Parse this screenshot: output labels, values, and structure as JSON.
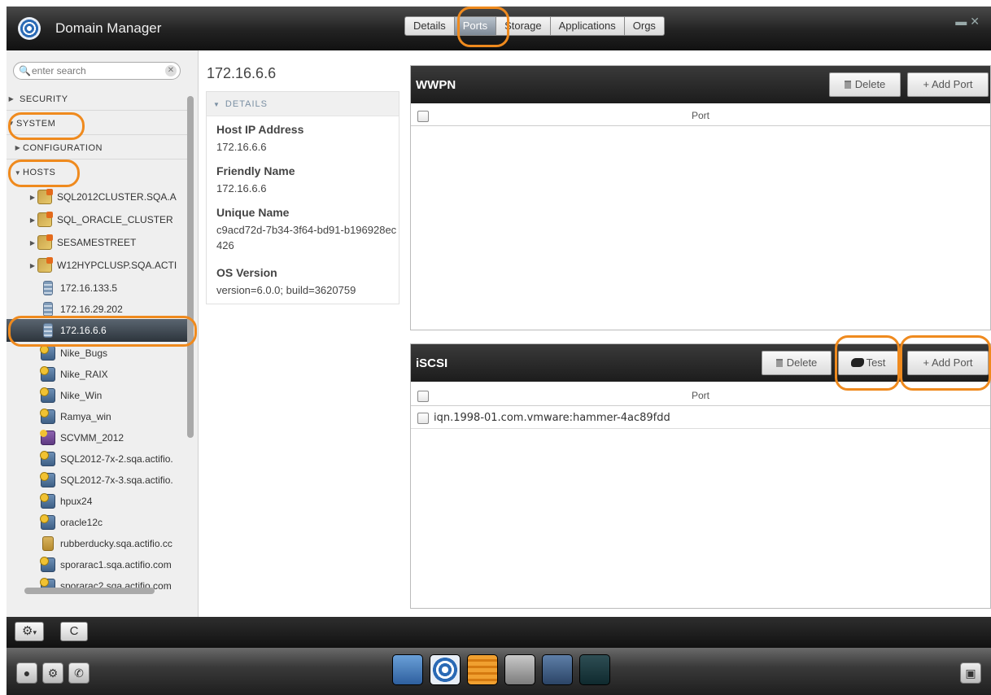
{
  "app": {
    "title": "Domain Manager"
  },
  "tabs": [
    {
      "label": "Details"
    },
    {
      "label": "Ports"
    },
    {
      "label": "Storage"
    },
    {
      "label": "Applications"
    },
    {
      "label": "Orgs"
    }
  ],
  "search": {
    "placeholder": "enter search"
  },
  "tree": {
    "security": "SECURITY",
    "system": "SYSTEM",
    "configuration": "CONFIGURATION",
    "hosts": "HOSTS",
    "items": [
      {
        "label": "SQL2012CLUSTER.SQA.A",
        "icon": "cluster-icon"
      },
      {
        "label": "SQL_ORACLE_CLUSTER",
        "icon": "cluster-icon"
      },
      {
        "label": "SESAMESTREET",
        "icon": "cluster-icon"
      },
      {
        "label": "W12HYPCLUSP.SQA.ACTI",
        "icon": "cluster-icon"
      },
      {
        "label": "172.16.133.5",
        "icon": "server-icon"
      },
      {
        "label": "172.16.29.202",
        "icon": "server-icon"
      },
      {
        "label": "172.16.6.6",
        "icon": "server-icon"
      },
      {
        "label": "Nike_Bugs",
        "icon": "host-icon"
      },
      {
        "label": "Nike_RAIX",
        "icon": "host-icon"
      },
      {
        "label": "Nike_Win",
        "icon": "host-icon"
      },
      {
        "label": "Ramya_win",
        "icon": "host-icon"
      },
      {
        "label": "SCVMM_2012",
        "icon": "scvmm-icon"
      },
      {
        "label": "SQL2012-7x-2.sqa.actifio.",
        "icon": "host-icon"
      },
      {
        "label": "SQL2012-7x-3.sqa.actifio.",
        "icon": "host-icon"
      },
      {
        "label": "hpux24",
        "icon": "host-icon"
      },
      {
        "label": "oracle12c",
        "icon": "host-icon"
      },
      {
        "label": "rubberducky.sqa.actifio.cc",
        "icon": "database-icon"
      },
      {
        "label": "sporarac1.sqa.actifio.com",
        "icon": "host-icon"
      },
      {
        "label": "sporarac2.sqa.actifio.com",
        "icon": "host-icon"
      }
    ]
  },
  "details": {
    "title": "172.16.6.6",
    "section": "DETAILS",
    "host_ip_label": "Host IP Address",
    "host_ip": "172.16.6.6",
    "friendly_name_label": "Friendly Name",
    "friendly_name": "172.16.6.6",
    "unique_name_label": "Unique Name",
    "unique_name": "c9acd72d-7b34-3f64-bd91-b196928ec426",
    "os_version_label": "OS Version",
    "os_version": "version=6.0.0; build=3620759"
  },
  "wwpn": {
    "title": "WWPN",
    "delete_label": "Delete",
    "add_label": "+ Add Port",
    "column": "Port",
    "rows": []
  },
  "iscsi": {
    "title": "iSCSI",
    "delete_label": "Delete",
    "test_label": "Test",
    "add_label": "+ Add Port",
    "column": "Port",
    "rows": [
      {
        "port": "iqn.1998-01.com.vmware:hammer-4ac89fdd"
      }
    ]
  },
  "colors": {
    "highlight": "#ef8a1e",
    "selected_row": "#2c343c",
    "header_dark": "#1c1c1c"
  }
}
